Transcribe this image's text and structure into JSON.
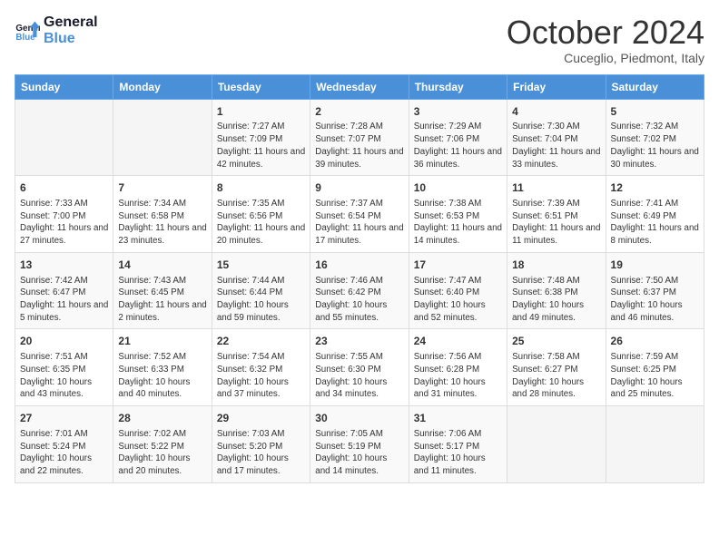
{
  "logo": {
    "line1": "General",
    "line2": "Blue"
  },
  "title": "October 2024",
  "subtitle": "Cuceglio, Piedmont, Italy",
  "headers": [
    "Sunday",
    "Monday",
    "Tuesday",
    "Wednesday",
    "Thursday",
    "Friday",
    "Saturday"
  ],
  "weeks": [
    [
      {
        "day": "",
        "sunrise": "",
        "sunset": "",
        "daylight": ""
      },
      {
        "day": "",
        "sunrise": "",
        "sunset": "",
        "daylight": ""
      },
      {
        "day": "1",
        "sunrise": "Sunrise: 7:27 AM",
        "sunset": "Sunset: 7:09 PM",
        "daylight": "Daylight: 11 hours and 42 minutes."
      },
      {
        "day": "2",
        "sunrise": "Sunrise: 7:28 AM",
        "sunset": "Sunset: 7:07 PM",
        "daylight": "Daylight: 11 hours and 39 minutes."
      },
      {
        "day": "3",
        "sunrise": "Sunrise: 7:29 AM",
        "sunset": "Sunset: 7:06 PM",
        "daylight": "Daylight: 11 hours and 36 minutes."
      },
      {
        "day": "4",
        "sunrise": "Sunrise: 7:30 AM",
        "sunset": "Sunset: 7:04 PM",
        "daylight": "Daylight: 11 hours and 33 minutes."
      },
      {
        "day": "5",
        "sunrise": "Sunrise: 7:32 AM",
        "sunset": "Sunset: 7:02 PM",
        "daylight": "Daylight: 11 hours and 30 minutes."
      }
    ],
    [
      {
        "day": "6",
        "sunrise": "Sunrise: 7:33 AM",
        "sunset": "Sunset: 7:00 PM",
        "daylight": "Daylight: 11 hours and 27 minutes."
      },
      {
        "day": "7",
        "sunrise": "Sunrise: 7:34 AM",
        "sunset": "Sunset: 6:58 PM",
        "daylight": "Daylight: 11 hours and 23 minutes."
      },
      {
        "day": "8",
        "sunrise": "Sunrise: 7:35 AM",
        "sunset": "Sunset: 6:56 PM",
        "daylight": "Daylight: 11 hours and 20 minutes."
      },
      {
        "day": "9",
        "sunrise": "Sunrise: 7:37 AM",
        "sunset": "Sunset: 6:54 PM",
        "daylight": "Daylight: 11 hours and 17 minutes."
      },
      {
        "day": "10",
        "sunrise": "Sunrise: 7:38 AM",
        "sunset": "Sunset: 6:53 PM",
        "daylight": "Daylight: 11 hours and 14 minutes."
      },
      {
        "day": "11",
        "sunrise": "Sunrise: 7:39 AM",
        "sunset": "Sunset: 6:51 PM",
        "daylight": "Daylight: 11 hours and 11 minutes."
      },
      {
        "day": "12",
        "sunrise": "Sunrise: 7:41 AM",
        "sunset": "Sunset: 6:49 PM",
        "daylight": "Daylight: 11 hours and 8 minutes."
      }
    ],
    [
      {
        "day": "13",
        "sunrise": "Sunrise: 7:42 AM",
        "sunset": "Sunset: 6:47 PM",
        "daylight": "Daylight: 11 hours and 5 minutes."
      },
      {
        "day": "14",
        "sunrise": "Sunrise: 7:43 AM",
        "sunset": "Sunset: 6:45 PM",
        "daylight": "Daylight: 11 hours and 2 minutes."
      },
      {
        "day": "15",
        "sunrise": "Sunrise: 7:44 AM",
        "sunset": "Sunset: 6:44 PM",
        "daylight": "Daylight: 10 hours and 59 minutes."
      },
      {
        "day": "16",
        "sunrise": "Sunrise: 7:46 AM",
        "sunset": "Sunset: 6:42 PM",
        "daylight": "Daylight: 10 hours and 55 minutes."
      },
      {
        "day": "17",
        "sunrise": "Sunrise: 7:47 AM",
        "sunset": "Sunset: 6:40 PM",
        "daylight": "Daylight: 10 hours and 52 minutes."
      },
      {
        "day": "18",
        "sunrise": "Sunrise: 7:48 AM",
        "sunset": "Sunset: 6:38 PM",
        "daylight": "Daylight: 10 hours and 49 minutes."
      },
      {
        "day": "19",
        "sunrise": "Sunrise: 7:50 AM",
        "sunset": "Sunset: 6:37 PM",
        "daylight": "Daylight: 10 hours and 46 minutes."
      }
    ],
    [
      {
        "day": "20",
        "sunrise": "Sunrise: 7:51 AM",
        "sunset": "Sunset: 6:35 PM",
        "daylight": "Daylight: 10 hours and 43 minutes."
      },
      {
        "day": "21",
        "sunrise": "Sunrise: 7:52 AM",
        "sunset": "Sunset: 6:33 PM",
        "daylight": "Daylight: 10 hours and 40 minutes."
      },
      {
        "day": "22",
        "sunrise": "Sunrise: 7:54 AM",
        "sunset": "Sunset: 6:32 PM",
        "daylight": "Daylight: 10 hours and 37 minutes."
      },
      {
        "day": "23",
        "sunrise": "Sunrise: 7:55 AM",
        "sunset": "Sunset: 6:30 PM",
        "daylight": "Daylight: 10 hours and 34 minutes."
      },
      {
        "day": "24",
        "sunrise": "Sunrise: 7:56 AM",
        "sunset": "Sunset: 6:28 PM",
        "daylight": "Daylight: 10 hours and 31 minutes."
      },
      {
        "day": "25",
        "sunrise": "Sunrise: 7:58 AM",
        "sunset": "Sunset: 6:27 PM",
        "daylight": "Daylight: 10 hours and 28 minutes."
      },
      {
        "day": "26",
        "sunrise": "Sunrise: 7:59 AM",
        "sunset": "Sunset: 6:25 PM",
        "daylight": "Daylight: 10 hours and 25 minutes."
      }
    ],
    [
      {
        "day": "27",
        "sunrise": "Sunrise: 7:01 AM",
        "sunset": "Sunset: 5:24 PM",
        "daylight": "Daylight: 10 hours and 22 minutes."
      },
      {
        "day": "28",
        "sunrise": "Sunrise: 7:02 AM",
        "sunset": "Sunset: 5:22 PM",
        "daylight": "Daylight: 10 hours and 20 minutes."
      },
      {
        "day": "29",
        "sunrise": "Sunrise: 7:03 AM",
        "sunset": "Sunset: 5:20 PM",
        "daylight": "Daylight: 10 hours and 17 minutes."
      },
      {
        "day": "30",
        "sunrise": "Sunrise: 7:05 AM",
        "sunset": "Sunset: 5:19 PM",
        "daylight": "Daylight: 10 hours and 14 minutes."
      },
      {
        "day": "31",
        "sunrise": "Sunrise: 7:06 AM",
        "sunset": "Sunset: 5:17 PM",
        "daylight": "Daylight: 10 hours and 11 minutes."
      },
      {
        "day": "",
        "sunrise": "",
        "sunset": "",
        "daylight": ""
      },
      {
        "day": "",
        "sunrise": "",
        "sunset": "",
        "daylight": ""
      }
    ]
  ]
}
